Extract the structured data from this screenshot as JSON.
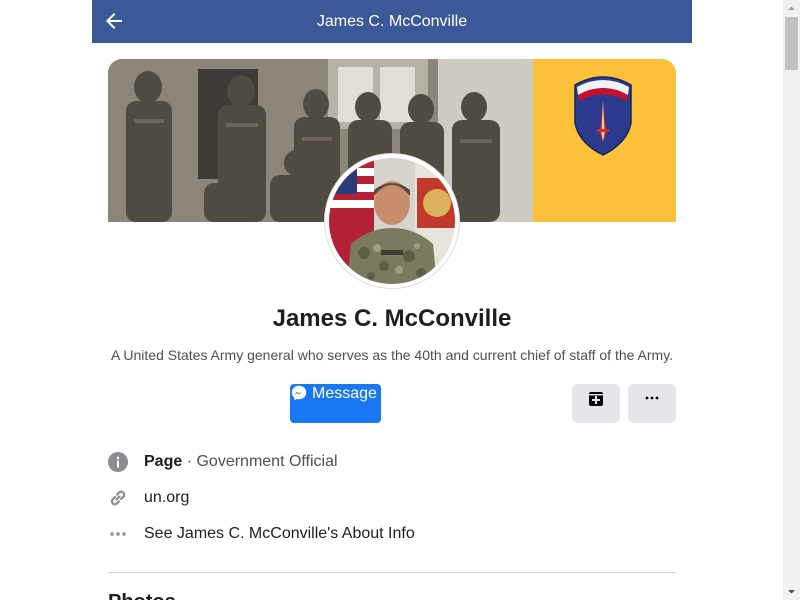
{
  "header": {
    "title": "James C. McConville",
    "back_icon": "arrow-left-icon"
  },
  "colors": {
    "header_bg": "#3b5998",
    "message_button": "#1877f2",
    "cover_panel": "#fcc13a",
    "secondary_button": "#e4e6eb"
  },
  "profile": {
    "name": "James C. McConville",
    "description": "A United States Army general who serves as the 40th and current chief of staff of the Army."
  },
  "actions": {
    "message_label": "Message",
    "message_icon": "messenger-icon",
    "save_icon": "bookmark-plus-icon",
    "more_icon": "more-dots-icon"
  },
  "info": {
    "category_type": "Page",
    "category_separator": " · ",
    "category_value": "Government Official",
    "website": "un.org",
    "about_link": "See James C. McConville's About Info"
  },
  "sections": {
    "photos_heading": "Photos"
  }
}
